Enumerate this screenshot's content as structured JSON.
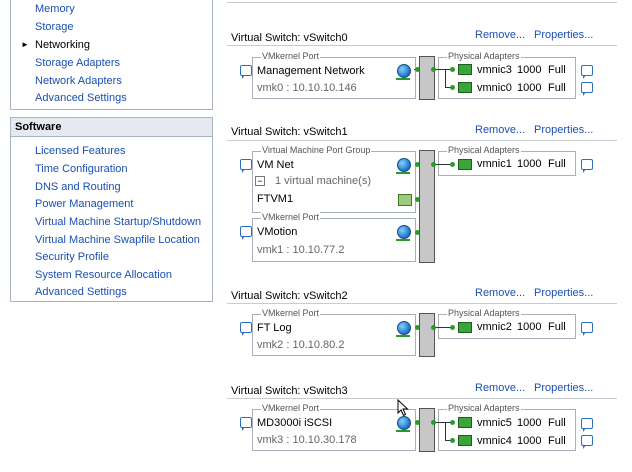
{
  "left_nav": {
    "hardware_items": [
      {
        "label": "Memory"
      },
      {
        "label": "Storage"
      },
      {
        "label": "Networking"
      },
      {
        "label": "Storage Adapters"
      },
      {
        "label": "Network Adapters"
      },
      {
        "label": "Advanced Settings"
      }
    ],
    "software_title": "Software",
    "software_items": [
      {
        "label": "Licensed Features"
      },
      {
        "label": "Time Configuration"
      },
      {
        "label": "DNS and Routing"
      },
      {
        "label": "Power Management"
      },
      {
        "label": "Virtual Machine Startup/Shutdown"
      },
      {
        "label": "Virtual Machine Swapfile Location"
      },
      {
        "label": "Security Profile"
      },
      {
        "label": "System Resource Allocation"
      },
      {
        "label": "Advanced Settings"
      }
    ]
  },
  "actions": {
    "remove": "Remove...",
    "properties": "Properties..."
  },
  "switches": [
    {
      "title": "Virtual Switch: vSwitch0",
      "groups": [
        {
          "type": "VMkernel Port",
          "name": "Management Network",
          "info": "vmk0 : 10.10.10.146"
        }
      ],
      "adapters_label": "Physical Adapters",
      "adapters": [
        {
          "name": "vmnic3",
          "speed": "1000",
          "duplex": "Full"
        },
        {
          "name": "vmnic0",
          "speed": "1000",
          "duplex": "Full"
        }
      ]
    },
    {
      "title": "Virtual Switch: vSwitch1",
      "groups": [
        {
          "type": "Virtual Machine Port Group",
          "name": "VM Net",
          "info": "1 virtual machine(s)",
          "vm": "FTVM1"
        },
        {
          "type": "VMkernel Port",
          "name": "VMotion",
          "info": "vmk1 : 10.10.77.2"
        }
      ],
      "adapters_label": "Physical Adapters",
      "adapters": [
        {
          "name": "vmnic1",
          "speed": "1000",
          "duplex": "Full"
        }
      ]
    },
    {
      "title": "Virtual Switch: vSwitch2",
      "groups": [
        {
          "type": "VMkernel Port",
          "name": "FT Log",
          "info": "vmk2 : 10.10.80.2"
        }
      ],
      "adapters_label": "Physical Adapters",
      "adapters": [
        {
          "name": "vmnic2",
          "speed": "1000",
          "duplex": "Full"
        }
      ]
    },
    {
      "title": "Virtual Switch: vSwitch3",
      "groups": [
        {
          "type": "VMkernel Port",
          "name": "MD3000i iSCSI",
          "info": "vmk3 : 10.10.30.178"
        }
      ],
      "adapters_label": "Physical Adapters",
      "adapters": [
        {
          "name": "vmnic5",
          "speed": "1000",
          "duplex": "Full"
        },
        {
          "name": "vmnic4",
          "speed": "1000",
          "duplex": "Full"
        }
      ]
    }
  ],
  "colors": {
    "link": "#1a4fb4",
    "nic_green": "#3aa63a",
    "panel_header": "#e6eaf0"
  }
}
